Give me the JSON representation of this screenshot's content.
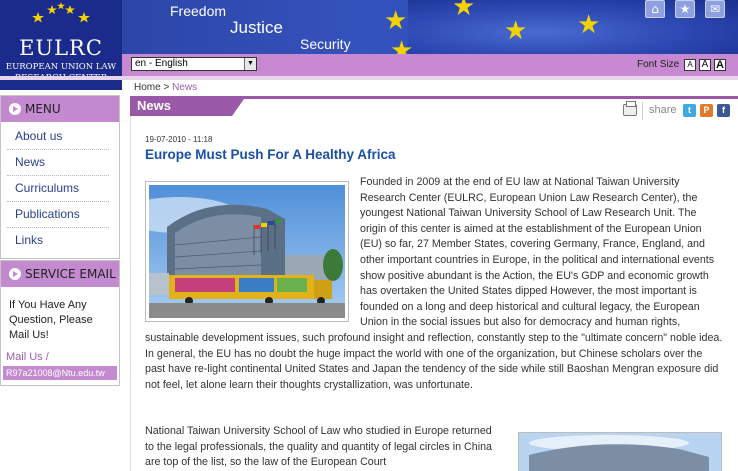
{
  "logo": {
    "name": "EULRC",
    "subtitle_line1": "EUROPEAN UNION LAW",
    "subtitle_line2": "RESEARCH CENTER"
  },
  "banner": {
    "word1": "Freedom",
    "word2": "Justice",
    "word3": "Security",
    "icons": [
      "home-icon",
      "star-icon",
      "mail-icon"
    ]
  },
  "toolbar": {
    "language_selected": "en - English",
    "font_size_label": "Font Size",
    "font_buttons": [
      "A",
      "A",
      "A"
    ]
  },
  "sidebar": {
    "menu_title": "MENU",
    "menu_items": [
      {
        "label": "About us"
      },
      {
        "label": "News"
      },
      {
        "label": "Curriculums"
      },
      {
        "label": "Publications"
      },
      {
        "label": "Links"
      }
    ],
    "service_title": "SERVICE EMAIL",
    "service_text": "If You Have Any Question, Please Mail Us!",
    "mail_us": "Mail Us /",
    "email": "R97a21008@Ntu.edu.tw"
  },
  "breadcrumb": {
    "home": "Home",
    "separator": ">",
    "current": "News"
  },
  "section_title": "News",
  "share": {
    "label": "share",
    "icons": [
      "print-icon",
      "twitter-icon",
      "plurk-icon",
      "facebook-icon"
    ],
    "twitter_letter": "t",
    "plurk_letter": "P",
    "facebook_letter": "f"
  },
  "article": {
    "date": "19-07-2010 - 11:18",
    "title": "Europe Must Push For A Healthy Africa",
    "paragraph1": "Founded in 2009 at the end of EU law at National Taiwan University Research Center (EULRC, European Union Law Research Center), the youngest National Taiwan University School of Law Research Unit. The origin of this center is aimed at the establishment of the European Union (EU) so far, 27 Member States, covering Germany, France, England, and other important countries in Europe, in the political and international events show positive abundant is the Action, the EU's GDP and economic growth has overtaken the United States dipped However, the most important is founded on a long and deep historical and cultural legacy, the European Union in the social issues but also for democracy and human rights, sustainable development issues, such profound insight and reflection, constantly step to the \"ultimate concern\" noble idea. In general, the EU has no doubt the huge impact the world with one of the organization, but Chinese scholars over the past have re-light continental United States and Japan the tendency of the side while still Baoshan Mengran exposure did not feel, let alone learn their thoughts crystallization, was unfortunate.",
    "paragraph2": "National Taiwan University School of Law who studied in Europe returned to the legal professionals, the quality and quantity of legal circles in China are top of the list, so the law of the European Court"
  },
  "colors": {
    "brand_blue": "#1a2b8c",
    "menu_purple": "#c48ad0",
    "section_purple": "#9a59a8",
    "link_blue": "#2a3f8f",
    "title_blue": "#1a4fa6"
  }
}
